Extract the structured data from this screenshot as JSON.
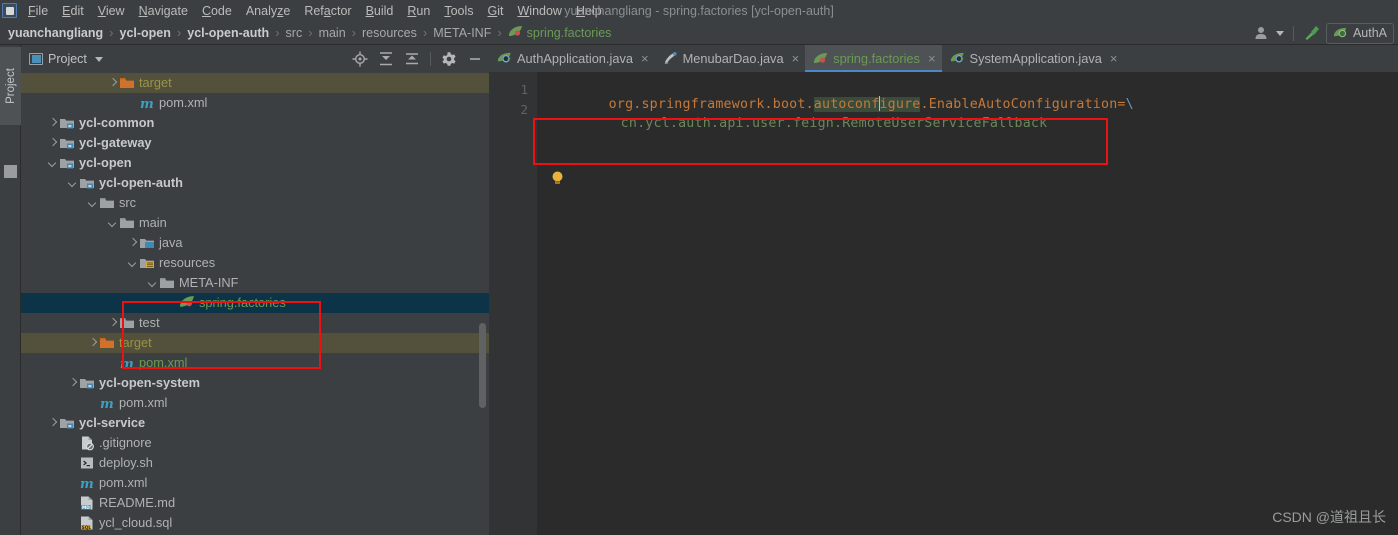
{
  "window": {
    "title": "yuanchangliang - spring.factories [ycl-open-auth]"
  },
  "menubar": {
    "items": [
      "File",
      "Edit",
      "View",
      "Navigate",
      "Code",
      "Analyze",
      "Refactor",
      "Build",
      "Run",
      "Tools",
      "Git",
      "Window",
      "Help"
    ]
  },
  "navbar": {
    "crumbs": [
      {
        "label": "yuanchangliang",
        "style": "bold"
      },
      {
        "label": "ycl-open",
        "style": "bold"
      },
      {
        "label": "ycl-open-auth",
        "style": "bold"
      },
      {
        "label": "src",
        "style": "plain"
      },
      {
        "label": "main",
        "style": "plain"
      },
      {
        "label": "resources",
        "style": "plain"
      },
      {
        "label": "META-INF",
        "style": "plain"
      },
      {
        "label": "spring.factories",
        "style": "file"
      }
    ],
    "separator": "›",
    "user_icon": "user-avatar-icon",
    "build_icon": "build-hammer-icon",
    "run_config_label": "AuthA"
  },
  "sidebar": {
    "tool_window_label": "Project",
    "header_title": "Project",
    "tools": [
      "locate-target-icon",
      "expand-all-icon",
      "collapse-all-icon",
      "settings-gear-icon",
      "hide-panel-icon"
    ],
    "tree": [
      {
        "label": "target",
        "indent": 4,
        "arrow": "right",
        "icon": "folder-target",
        "style": "olive",
        "row": "target"
      },
      {
        "label": "pom.xml",
        "indent": 5,
        "arrow": "none",
        "icon": "maven",
        "style": "gray",
        "row": "normal"
      },
      {
        "label": "ycl-common",
        "indent": 1,
        "arrow": "right",
        "icon": "module",
        "style": "bold",
        "row": "normal"
      },
      {
        "label": "ycl-gateway",
        "indent": 1,
        "arrow": "right",
        "icon": "module",
        "style": "bold",
        "row": "normal"
      },
      {
        "label": "ycl-open",
        "indent": 1,
        "arrow": "down",
        "icon": "module",
        "style": "bold",
        "row": "normal"
      },
      {
        "label": "ycl-open-auth",
        "indent": 2,
        "arrow": "down",
        "icon": "module",
        "style": "bold",
        "row": "normal"
      },
      {
        "label": "src",
        "indent": 3,
        "arrow": "down",
        "icon": "folder-plain",
        "style": "gray",
        "row": "normal"
      },
      {
        "label": "main",
        "indent": 4,
        "arrow": "down",
        "icon": "folder-plain",
        "style": "gray",
        "row": "normal"
      },
      {
        "label": "java",
        "indent": 5,
        "arrow": "right",
        "icon": "folder-source",
        "style": "gray",
        "row": "normal"
      },
      {
        "label": "resources",
        "indent": 5,
        "arrow": "down",
        "icon": "folder-resource",
        "style": "gray",
        "row": "normal"
      },
      {
        "label": "META-INF",
        "indent": 6,
        "arrow": "down",
        "icon": "folder-plain",
        "style": "gray",
        "row": "normal"
      },
      {
        "label": "spring.factories",
        "indent": 7,
        "arrow": "none",
        "icon": "spring",
        "style": "green",
        "row": "selected"
      },
      {
        "label": "test",
        "indent": 4,
        "arrow": "right",
        "icon": "folder-plain",
        "style": "gray",
        "row": "normal"
      },
      {
        "label": "target",
        "indent": 3,
        "arrow": "right",
        "icon": "folder-target",
        "style": "olive",
        "row": "target"
      },
      {
        "label": "pom.xml",
        "indent": 4,
        "arrow": "none",
        "icon": "maven",
        "style": "xml",
        "row": "normal"
      },
      {
        "label": "ycl-open-system",
        "indent": 2,
        "arrow": "right",
        "icon": "module",
        "style": "bold",
        "row": "normal"
      },
      {
        "label": "pom.xml",
        "indent": 3,
        "arrow": "none",
        "icon": "maven",
        "style": "gray",
        "row": "normal"
      },
      {
        "label": "ycl-service",
        "indent": 1,
        "arrow": "right",
        "icon": "module",
        "style": "bold",
        "row": "normal"
      },
      {
        "label": ".gitignore",
        "indent": 2,
        "arrow": "none",
        "icon": "gitignore",
        "style": "gray",
        "row": "normal"
      },
      {
        "label": "deploy.sh",
        "indent": 2,
        "arrow": "none",
        "icon": "shell",
        "style": "gray",
        "row": "normal"
      },
      {
        "label": "pom.xml",
        "indent": 2,
        "arrow": "none",
        "icon": "maven",
        "style": "gray",
        "row": "normal"
      },
      {
        "label": "README.md",
        "indent": 2,
        "arrow": "none",
        "icon": "markdown",
        "style": "gray",
        "row": "normal"
      },
      {
        "label": "ycl_cloud.sql",
        "indent": 2,
        "arrow": "none",
        "icon": "sql",
        "style": "gray",
        "row": "normal"
      }
    ]
  },
  "editor": {
    "tabs": [
      {
        "label": "AuthApplication.java",
        "icon": "spring-boot-class-icon",
        "active": false
      },
      {
        "label": "MenubarDao.java",
        "icon": "java-interface-icon",
        "active": false
      },
      {
        "label": "spring.factories",
        "icon": "spring-leaf-icon",
        "active": true
      },
      {
        "label": "SystemApplication.java",
        "icon": "spring-boot-class-icon",
        "active": false
      }
    ],
    "close_glyph": "×",
    "line_numbers": [
      "1",
      "2"
    ],
    "lines": [
      {
        "num": "1",
        "key_before": "org.springframework.boot.",
        "key_selected": "autoconfigure",
        "key_after": ".EnableAutoConfiguration",
        "equals": "=",
        "continuation": "\\"
      },
      {
        "num": "2",
        "value": "cn.ycl.auth.api.user.feign.RemoteUserServiceFallback"
      }
    ],
    "intention_icon": "lightbulb-icon"
  },
  "annotations": {
    "box_color": "#ee1111",
    "tree_box_target": "resources / META-INF / spring.factories",
    "code_box_target": "line 1-2 property entry"
  },
  "watermark": "CSDN @道祖且长",
  "colors": {
    "panel_bg": "#3c3f41",
    "editor_bg": "#2b2b2b",
    "gutter_bg": "#313335",
    "selection_row": "#0d3349",
    "target_row": "#53503c",
    "accent_tab": "#4a88c7",
    "green_text": "#6a9b55",
    "orange_key": "#c4793a",
    "olive_text": "#9a9545"
  }
}
